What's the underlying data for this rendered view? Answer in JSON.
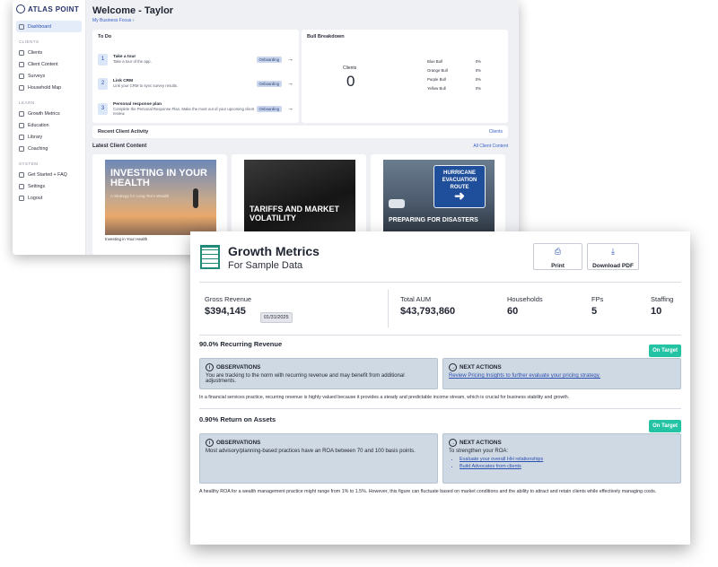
{
  "dashboard": {
    "logo": "ATLAS POINT",
    "sidebar": {
      "top_items": [
        {
          "label": "Dashboard"
        }
      ],
      "sections": [
        {
          "header": "CLIENTS",
          "items": [
            {
              "label": "Clients"
            },
            {
              "label": "Client Content"
            },
            {
              "label": "Surveys"
            },
            {
              "label": "Household Map"
            }
          ]
        },
        {
          "header": "LEARN",
          "items": [
            {
              "label": "Growth Metrics"
            },
            {
              "label": "Education"
            },
            {
              "label": "Library"
            },
            {
              "label": "Coaching"
            }
          ]
        },
        {
          "header": "SYSTEM",
          "items": [
            {
              "label": "Get Started + FAQ"
            },
            {
              "label": "Settings"
            },
            {
              "label": "Logout"
            }
          ]
        }
      ]
    },
    "welcome": "Welcome - Taylor",
    "focus_link": "My Business Focus ›",
    "todo": {
      "title": "To Do",
      "items": [
        {
          "num": "1",
          "title": "Take a tour",
          "desc": "Take a tour of the app.",
          "tag": "Onboarding"
        },
        {
          "num": "2",
          "title": "Link CRM",
          "desc": "Link your CRM to sync survey results.",
          "tag": "Onboarding"
        },
        {
          "num": "3",
          "title": "Personal response plan",
          "desc": "Complete the Personal Response Plan. Make the most out of your upcoming client review.",
          "tag": "Onboarding"
        }
      ]
    },
    "bull": {
      "title": "Bull Breakdown",
      "clients_label": "Clients",
      "clients_value": "0",
      "rows": [
        {
          "label": "Blue Bull",
          "value": "0%"
        },
        {
          "label": "Orange Bull",
          "value": "0%"
        },
        {
          "label": "Purple Bull",
          "value": "0%"
        },
        {
          "label": "Yellow Bull",
          "value": "0%"
        }
      ]
    },
    "recent": {
      "title": "Recent Client Activity",
      "link": "Clients"
    },
    "latest": {
      "title": "Latest Client Content",
      "link": "All Client Content"
    },
    "content": [
      {
        "headline": "INVESTING IN YOUR HEALTH",
        "subline": "A Strategy for Long-Term Wealth",
        "caption": "Investing in Your Health"
      },
      {
        "headline": "TARIFFS AND MARKET VOLATILITY",
        "caption": ""
      },
      {
        "headline": "PREPARING FOR DISASTERS",
        "sign": "HURRICANE EVACUATION ROUTE",
        "caption": ""
      }
    ]
  },
  "report": {
    "title": "Growth Metrics",
    "subtitle": "For Sample Data",
    "print_label": "Print",
    "pdf_label": "Download PDF",
    "metrics": {
      "gross_revenue": {
        "label": "Gross Revenue",
        "value": "$394,145",
        "date": "01/31/2025"
      },
      "total_aum": {
        "label": "Total AUM",
        "value": "$43,793,860"
      },
      "households": {
        "label": "Households",
        "value": "60"
      },
      "fps": {
        "label": "FPs",
        "value": "5"
      },
      "staffing": {
        "label": "Staffing",
        "value": "10"
      }
    },
    "sections": [
      {
        "title": "90.0% Recurring Revenue",
        "status": "On Target",
        "observations_title": "OBSERVATIONS",
        "observations_text": "You are tracking to the norm with recurring revenue and may benefit from additional adjustments.",
        "actions_title": "NEXT ACTIONS",
        "actions_link": "Review Pricing Insights to further evaluate your pricing strategy.",
        "note": "In a financial services practice, recurring revenue is highly valued because it provides a steady and predictable income stream, which is crucial for business stability and growth."
      },
      {
        "title": "0.90% Return on Assets",
        "status": "On Target",
        "observations_title": "OBSERVATIONS",
        "observations_text": "Most advisory/planning-based practices have an ROA between 70 and 100 basis points.",
        "actions_title": "NEXT ACTIONS",
        "actions_intro": "To strengthen your ROA:",
        "actions_list": [
          "Evaluate your overall HH relationships",
          "Build Advocates from clients"
        ],
        "note": "A healthy ROA for a wealth management practice might range from 1% to 1.5%. However, this figure can fluctuate based on market conditions and the ability to attract and retain clients while effectively managing costs."
      }
    ]
  },
  "colors": {
    "accent": "#2a4fb0",
    "status_on_target": "#24c3a4",
    "panel_bg": "#cfd9e4",
    "brand_teal": "#1f8a78"
  }
}
